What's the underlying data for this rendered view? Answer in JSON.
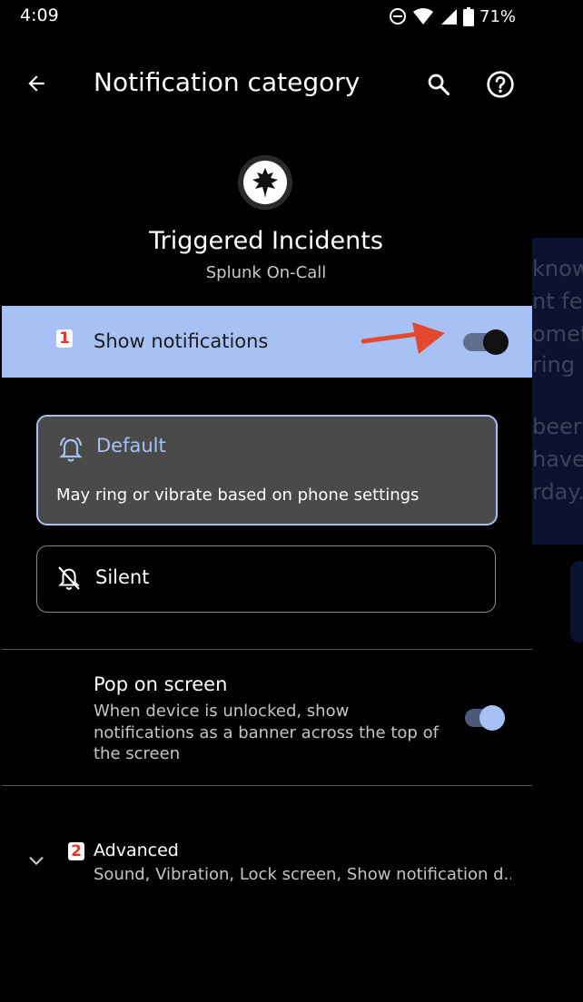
{
  "status_bar": {
    "time": "4:09",
    "battery": "71%"
  },
  "app_bar": {
    "title": "Notification category"
  },
  "header": {
    "channel_name": "Triggered Incidents",
    "app_name": "Splunk On-Call"
  },
  "show_notifications": {
    "label": "Show notifications",
    "annotation": "1",
    "enabled": true
  },
  "options": {
    "default": {
      "title": "Default",
      "description": "May ring or vibrate based on phone settings",
      "selected": true
    },
    "silent": {
      "title": "Silent",
      "selected": false
    }
  },
  "pop_on_screen": {
    "title": "Pop on screen",
    "description": "When device is unlocked, show notifications as a banner across the top of the screen",
    "enabled": true
  },
  "advanced": {
    "annotation": "2",
    "title": "Advanced",
    "summary": "Sound, Vibration, Lock screen, Show notification d.."
  },
  "background_app": {
    "lines": [
      "know",
      "nt fea",
      "omet",
      "ring",
      "beer",
      "have",
      "rday."
    ]
  },
  "icons": {
    "back": "arrow-back-icon",
    "search": "search-icon",
    "help": "help-icon",
    "app": "leaf-icon",
    "default_option": "bell-ring-icon",
    "silent_option": "bell-off-icon",
    "expand": "chevron-down-icon"
  },
  "colors": {
    "accent": "#a8c1f4",
    "annotation": "#e5352b",
    "background": "#000000"
  }
}
